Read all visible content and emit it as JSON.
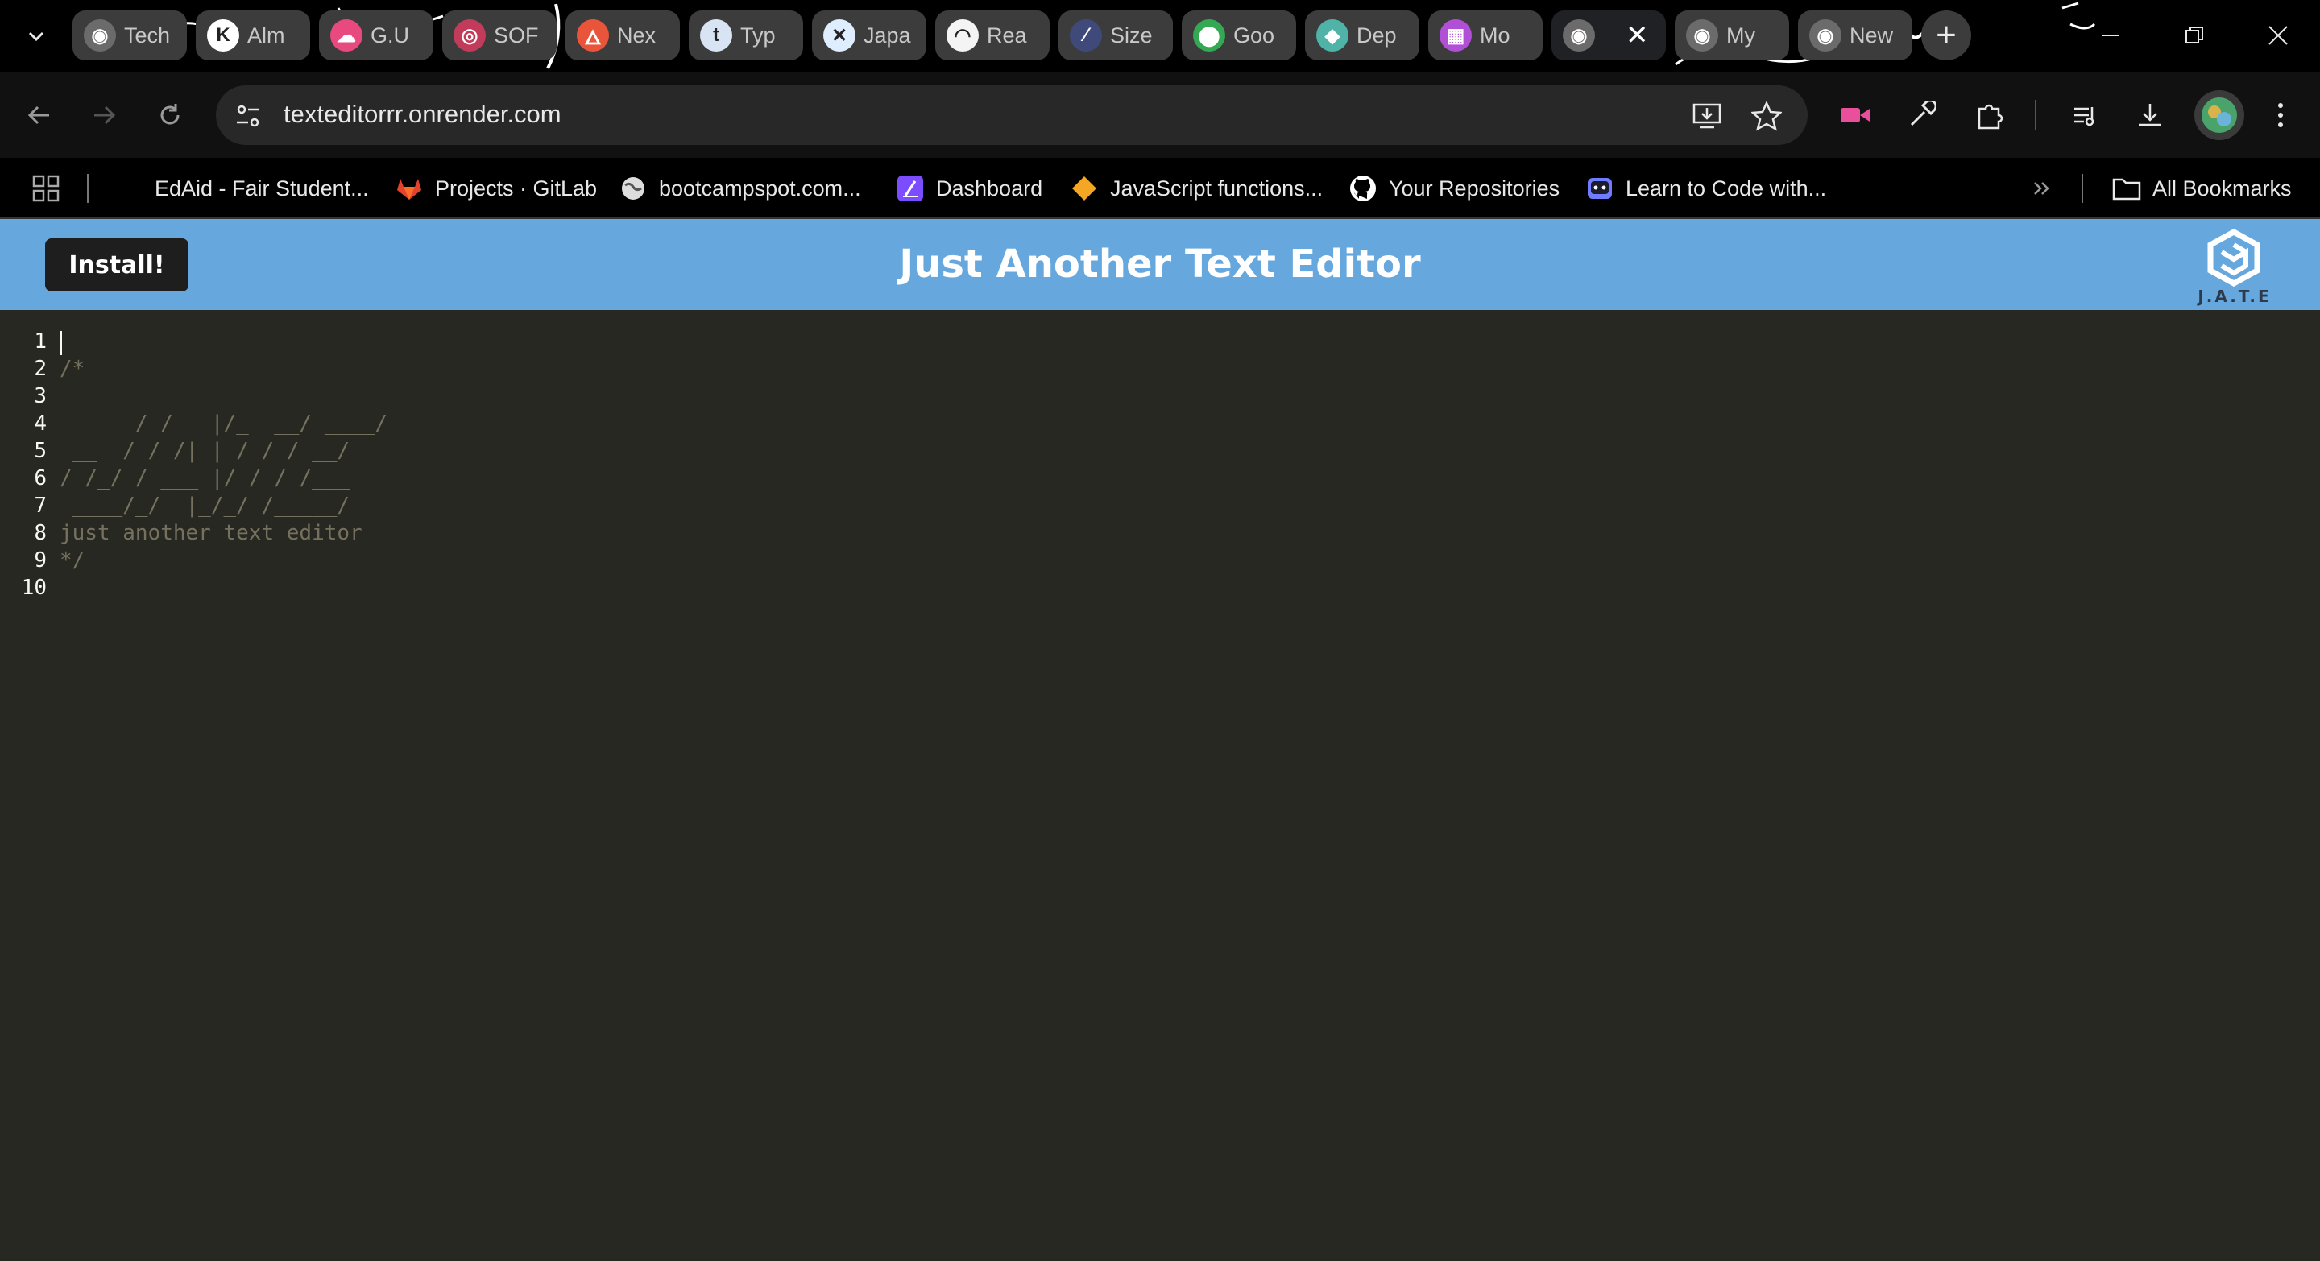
{
  "browser": {
    "tabs": [
      {
        "label": "Tech",
        "icon": "globe-icon"
      },
      {
        "label": "Alm",
        "icon": "k-logo-icon"
      },
      {
        "label": "G.U",
        "icon": "cloud-icon"
      },
      {
        "label": "SOF",
        "icon": "circle-badge-icon"
      },
      {
        "label": "Nex",
        "icon": "flame-icon"
      },
      {
        "label": "Typ",
        "icon": "t-logo-icon"
      },
      {
        "label": "Japa",
        "icon": "x-logo-icon"
      },
      {
        "label": "Rea",
        "icon": "rainbow-icon"
      },
      {
        "label": "Size",
        "icon": "streak-icon"
      },
      {
        "label": "Goo",
        "icon": "maps-pin-icon"
      },
      {
        "label": "Dep",
        "icon": "diamond-icon"
      },
      {
        "label": "Mo",
        "icon": "grid-pattern-icon"
      },
      {
        "label": "",
        "icon": "globe-icon",
        "active": true
      },
      {
        "label": "My",
        "icon": "globe-icon"
      },
      {
        "label": "New",
        "icon": "globe-icon"
      }
    ],
    "url": "texteditorrr.onrender.com",
    "bookmarks": [
      {
        "label": "EdAid - Fair Student...",
        "icon": "none"
      },
      {
        "label": "Projects · GitLab",
        "icon": "gitlab-icon"
      },
      {
        "label": "bootcampspot.com...",
        "icon": "globe-icon"
      },
      {
        "label": "Dashboard",
        "icon": "slash-logo-icon"
      },
      {
        "label": "JavaScript functions...",
        "icon": "diamond-icon"
      },
      {
        "label": "Your Repositories",
        "icon": "github-icon"
      },
      {
        "label": "Learn to Code with...",
        "icon": "robot-icon"
      }
    ],
    "all_bookmarks_label": "All Bookmarks"
  },
  "app": {
    "install_label": "Install!",
    "title": "Just Another Text Editor",
    "logo_text": "J.A.T.E"
  },
  "editor": {
    "lines": [
      {
        "n": "1",
        "text": ""
      },
      {
        "n": "2",
        "text": "/*"
      },
      {
        "n": "3",
        "text": "       ____  _____________"
      },
      {
        "n": "4",
        "text": "      / /   |/_  __/ ____/"
      },
      {
        "n": "5",
        "text": " __  / / /| | / / / __/"
      },
      {
        "n": "6",
        "text": "/ /_/ / ___ |/ / / /___"
      },
      {
        "n": "7",
        "text": " ____/_/  |_/_/ /_____/"
      },
      {
        "n": "8",
        "text": "just another text editor"
      },
      {
        "n": "9",
        "text": "*/"
      },
      {
        "n": "10",
        "text": ""
      }
    ]
  },
  "colors": {
    "header_bg": "#66a8de",
    "editor_bg": "#272822",
    "comment": "#75715e",
    "line_number": "#f8f8f2"
  }
}
